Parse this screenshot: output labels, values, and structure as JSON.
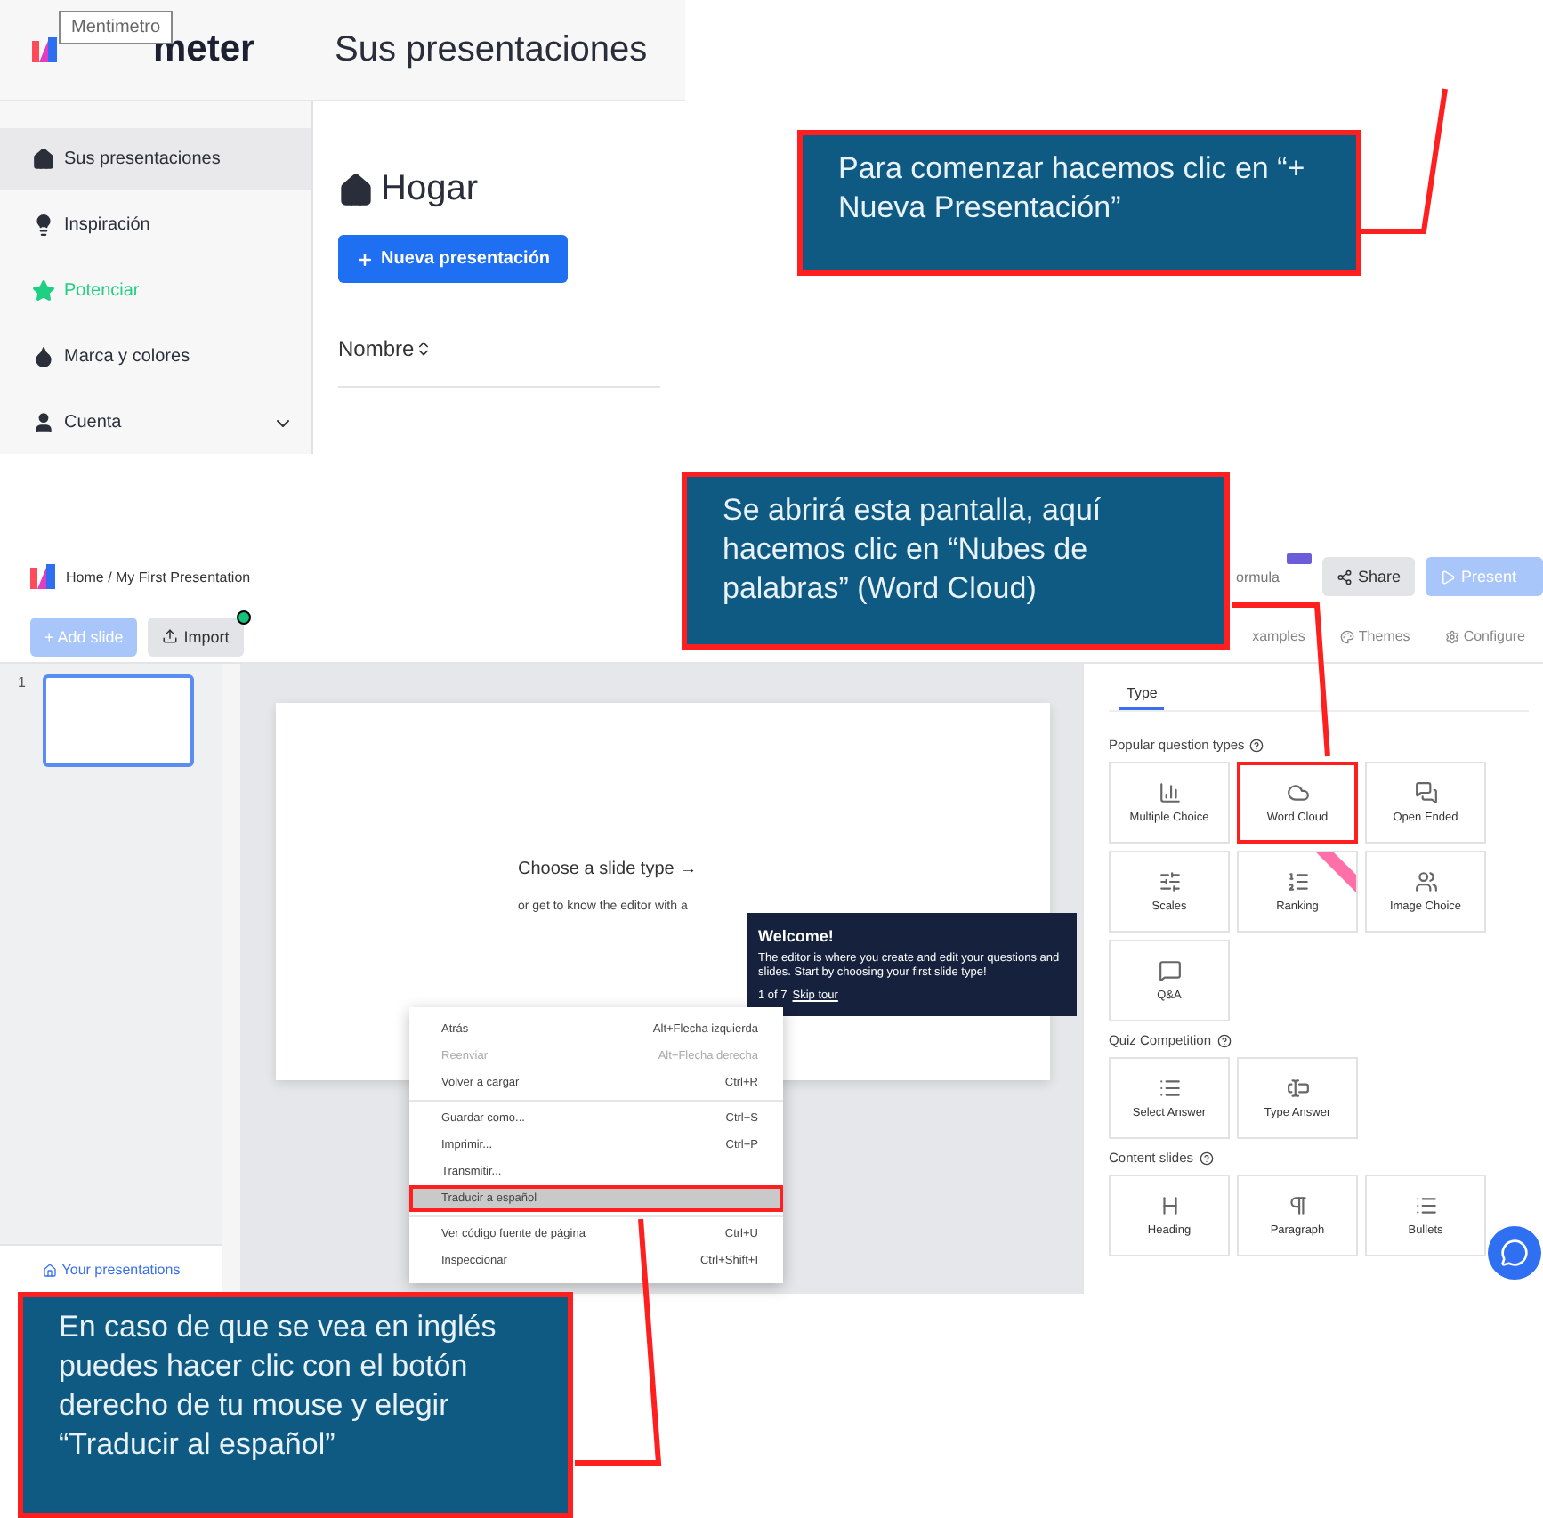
{
  "home_screen": {
    "logo_tooltip": "Mentimetro",
    "logo_text": "meter",
    "page_title": "Sus presentaciones",
    "sidebar": {
      "items": [
        {
          "label": "Sus presentaciones",
          "kind": "home",
          "selected": true,
          "color": "#2b2f3a"
        },
        {
          "label": "Inspiración",
          "kind": "bulb",
          "selected": false,
          "color": "#2b2f3a"
        },
        {
          "label": "Potenciar",
          "kind": "star",
          "selected": false,
          "color": "#1fcf83"
        },
        {
          "label": "Marca y colores",
          "kind": "drop",
          "selected": false,
          "color": "#2b2f3a"
        },
        {
          "label": "Cuenta",
          "kind": "account",
          "selected": false,
          "color": "#2b2f3a",
          "expandable": true
        }
      ]
    },
    "heading": "Hogar",
    "new_button": "Nueva presentación",
    "column_header": "Nombre"
  },
  "callouts": [
    {
      "text": "Para comenzar hacemos clic en “+ Nueva Presentación”"
    },
    {
      "text": "Se abrirá esta pantalla, aquí hacemos clic en “Nubes de palabras” (Word Cloud)"
    },
    {
      "text": "En caso de que se vea en inglés puedes hacer clic con el botón derecho de tu mouse y elegir “Traducir al español”"
    }
  ],
  "editor_screen": {
    "breadcrumb": "Home / My First Presentation",
    "partial_label": "ormula",
    "share_button": "Share",
    "present_button": "Present",
    "add_slide_button": "+ Add slide",
    "import_button": "Import",
    "import_notification": true,
    "toolbar_links": [
      {
        "label": "xamples",
        "kind": "examples"
      },
      {
        "label": "Themes",
        "kind": "themes"
      },
      {
        "label": "Configure",
        "kind": "configure"
      }
    ],
    "slides": [
      {
        "number": "1",
        "selected": true
      }
    ],
    "your_presentations": "Your presentations",
    "canvas": {
      "prompt": "Choose a slide type →",
      "subprompt": "or get to know the editor with a"
    },
    "welcome_tooltip": {
      "title": "Welcome!",
      "body": "The editor is where you create and edit your questions and slides. Start by choosing your first slide type!",
      "step": "1 of 7",
      "skip_link": "Skip tour"
    },
    "context_menu": {
      "groups": [
        [
          {
            "label": "Atrás",
            "shortcut": "Alt+Flecha izquierda",
            "disabled": false,
            "highlighted": false
          },
          {
            "label": "Reenviar",
            "shortcut": "Alt+Flecha derecha",
            "disabled": true,
            "highlighted": false
          },
          {
            "label": "Volver a cargar",
            "shortcut": "Ctrl+R",
            "disabled": false,
            "highlighted": false
          }
        ],
        [
          {
            "label": "Guardar como...",
            "shortcut": "Ctrl+S",
            "disabled": false,
            "highlighted": false
          },
          {
            "label": "Imprimir...",
            "shortcut": "Ctrl+P",
            "disabled": false,
            "highlighted": false
          },
          {
            "label": "Transmitir...",
            "disabled": false,
            "highlighted": false
          },
          {
            "label": "Traducir a español",
            "disabled": false,
            "highlighted": true
          }
        ],
        [
          {
            "label": "Ver código fuente de página",
            "shortcut": "Ctrl+U",
            "disabled": false,
            "highlighted": false
          },
          {
            "label": "Inspeccionar",
            "shortcut": "Ctrl+Shift+I",
            "disabled": false,
            "highlighted": false
          }
        ]
      ]
    },
    "panel": {
      "tabs": [
        {
          "label": "Type",
          "selected": true
        }
      ],
      "sections": [
        {
          "title": "Popular question types",
          "items": [
            {
              "label": "Multiple Choice",
              "kind": "bars",
              "highlighted": false,
              "ribbon": false
            },
            {
              "label": "Word Cloud",
              "kind": "cloud",
              "highlighted": true,
              "ribbon": false
            },
            {
              "label": "Open Ended",
              "kind": "chat",
              "highlighted": false,
              "ribbon": false
            },
            {
              "label": "Scales",
              "kind": "sliders",
              "highlighted": false,
              "ribbon": false
            },
            {
              "label": "Ranking",
              "kind": "ranking",
              "highlighted": false,
              "ribbon": true
            },
            {
              "label": "Image Choice",
              "kind": "people",
              "highlighted": false,
              "ribbon": false
            },
            {
              "label": "Q&A",
              "kind": "qa",
              "highlighted": false,
              "ribbon": false
            }
          ]
        },
        {
          "title": "Quiz Competition",
          "items": [
            {
              "label": "Select Answer",
              "kind": "list",
              "highlighted": false,
              "ribbon": false
            },
            {
              "label": "Type Answer",
              "kind": "input",
              "highlighted": false,
              "ribbon": false
            }
          ]
        },
        {
          "title": "Content slides",
          "items": [
            {
              "label": "Heading",
              "kind": "heading",
              "highlighted": false,
              "ribbon": false
            },
            {
              "label": "Paragraph",
              "kind": "paragraph",
              "highlighted": false,
              "ribbon": false
            },
            {
              "label": "Bullets",
              "kind": "list",
              "highlighted": false,
              "ribbon": false
            }
          ]
        }
      ]
    }
  }
}
